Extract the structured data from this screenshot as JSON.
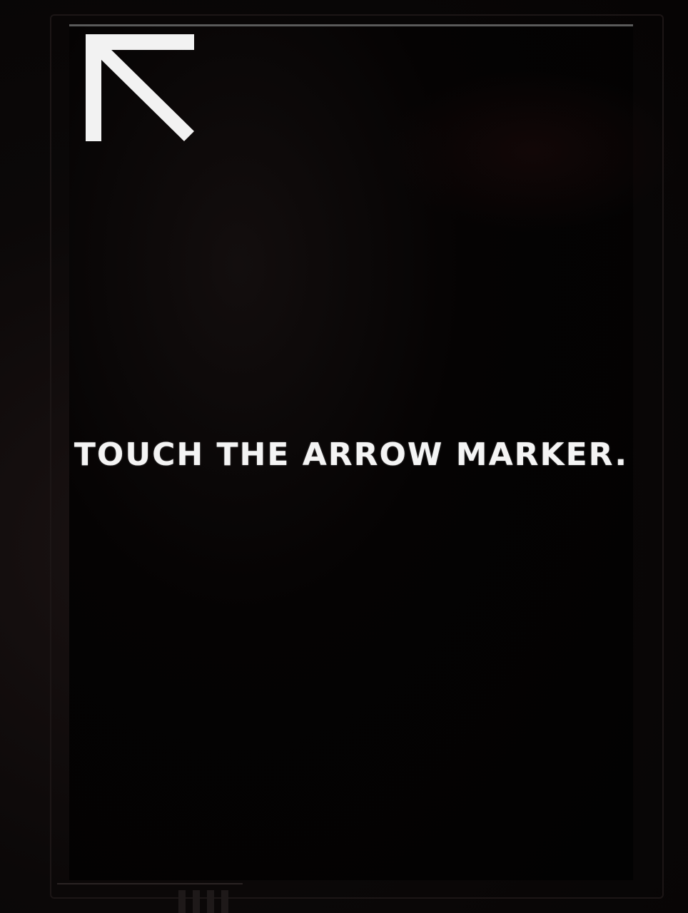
{
  "screen": {
    "instruction_text": "TOUCH THE ARROW MARKER.",
    "marker_icon": "arrow-up-left-icon",
    "colors": {
      "background": "#020202",
      "foreground": "#f4f4f4"
    }
  }
}
